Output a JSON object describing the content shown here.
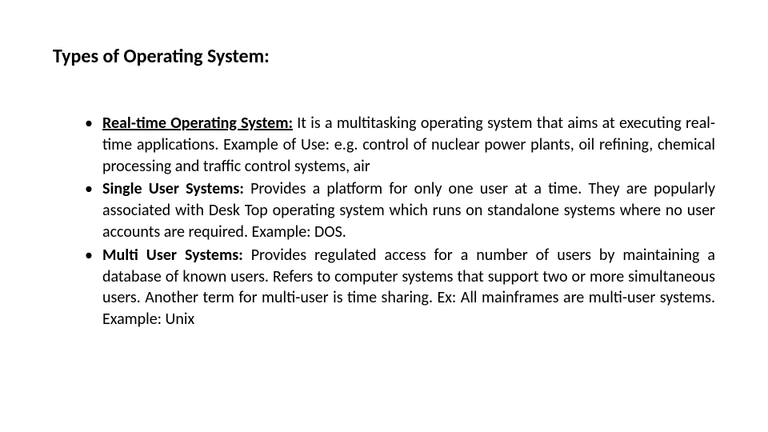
{
  "title": "Types of Operating System:",
  "items": [
    {
      "term": "Real-time Operating System:",
      "underline": true,
      "desc": " It is a multitasking operating system that aims at executing real-time applications. Example of Use: e.g. control of nuclear power plants, oil refining, chemical processing and traffic control systems, air"
    },
    {
      "term": "Single User Systems:",
      "underline": false,
      "desc": " Provides a platform for only one user at a time. They are popularly associated with Desk Top operating system which runs on standalone systems where no user accounts are required. Example: DOS."
    },
    {
      "term": "Multi User Systems:",
      "underline": false,
      "desc": " Provides regulated access for a number of users by maintaining a database of known users. Refers to computer systems that support two or more simultaneous users. Another term for multi-user is time sharing. Ex: All mainframes are multi-user systems. Example: Unix"
    }
  ]
}
